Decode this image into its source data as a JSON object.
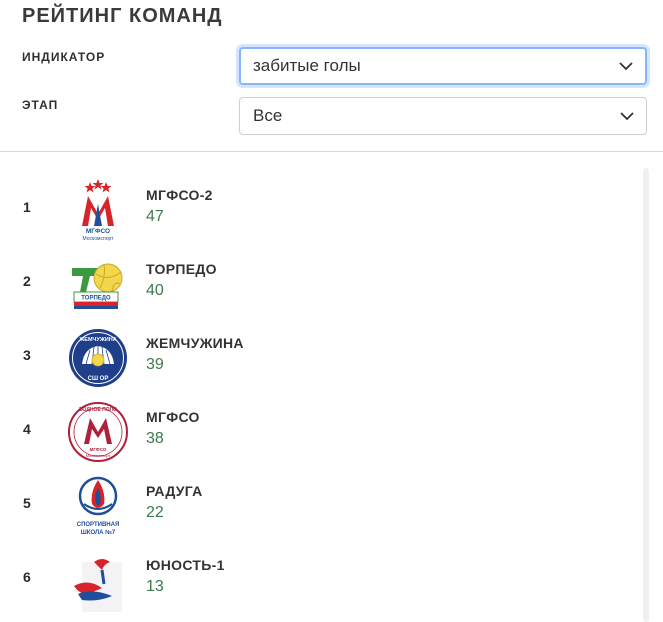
{
  "header": {
    "title": "РЕЙТИНГ КОМАНД"
  },
  "filters": {
    "indicator": {
      "label": "ИНДИКАТОР",
      "value": "забитые голы"
    },
    "stage": {
      "label": "ЭТАП",
      "value": "Все"
    }
  },
  "teams": [
    {
      "rank": "1",
      "name": "МГФСО-2",
      "value": "47",
      "logo": {
        "icon": "mgfso-logo",
        "text": [
          "МГФСО",
          "Москомспорт"
        ]
      }
    },
    {
      "rank": "2",
      "name": "ТОРПЕДО",
      "value": "40",
      "logo": {
        "icon": "torpedo-logo",
        "text": [
          "ТОРПЕДО"
        ]
      }
    },
    {
      "rank": "3",
      "name": "ЖЕМЧУЖИНА",
      "value": "39",
      "logo": {
        "icon": "pearl-logo",
        "text": [
          "ЖЕМЧУЖИНА",
          "СШ ОР"
        ]
      }
    },
    {
      "rank": "4",
      "name": "МГФСО",
      "value": "38",
      "logo": {
        "icon": "mgfso-water-polo-logo",
        "text": [
          "ВОДНОЕ ПОЛО",
          "МГФСО",
          "Москомспорт"
        ]
      }
    },
    {
      "rank": "5",
      "name": "РАДУГА",
      "value": "22",
      "logo": {
        "icon": "sport-school-logo",
        "text": [
          "СПОРТИВНАЯ",
          "ШКОЛА №7"
        ]
      }
    },
    {
      "rank": "6",
      "name": "ЮНОСТЬ-1",
      "value": "13",
      "logo": {
        "icon": "yunost-logo",
        "text": []
      }
    }
  ],
  "colors": {
    "value_green": "#3d7a4c",
    "accent_red": "#d8232a",
    "accent_blue": "#1f4e9a",
    "focus_border": "#86b7fe"
  }
}
